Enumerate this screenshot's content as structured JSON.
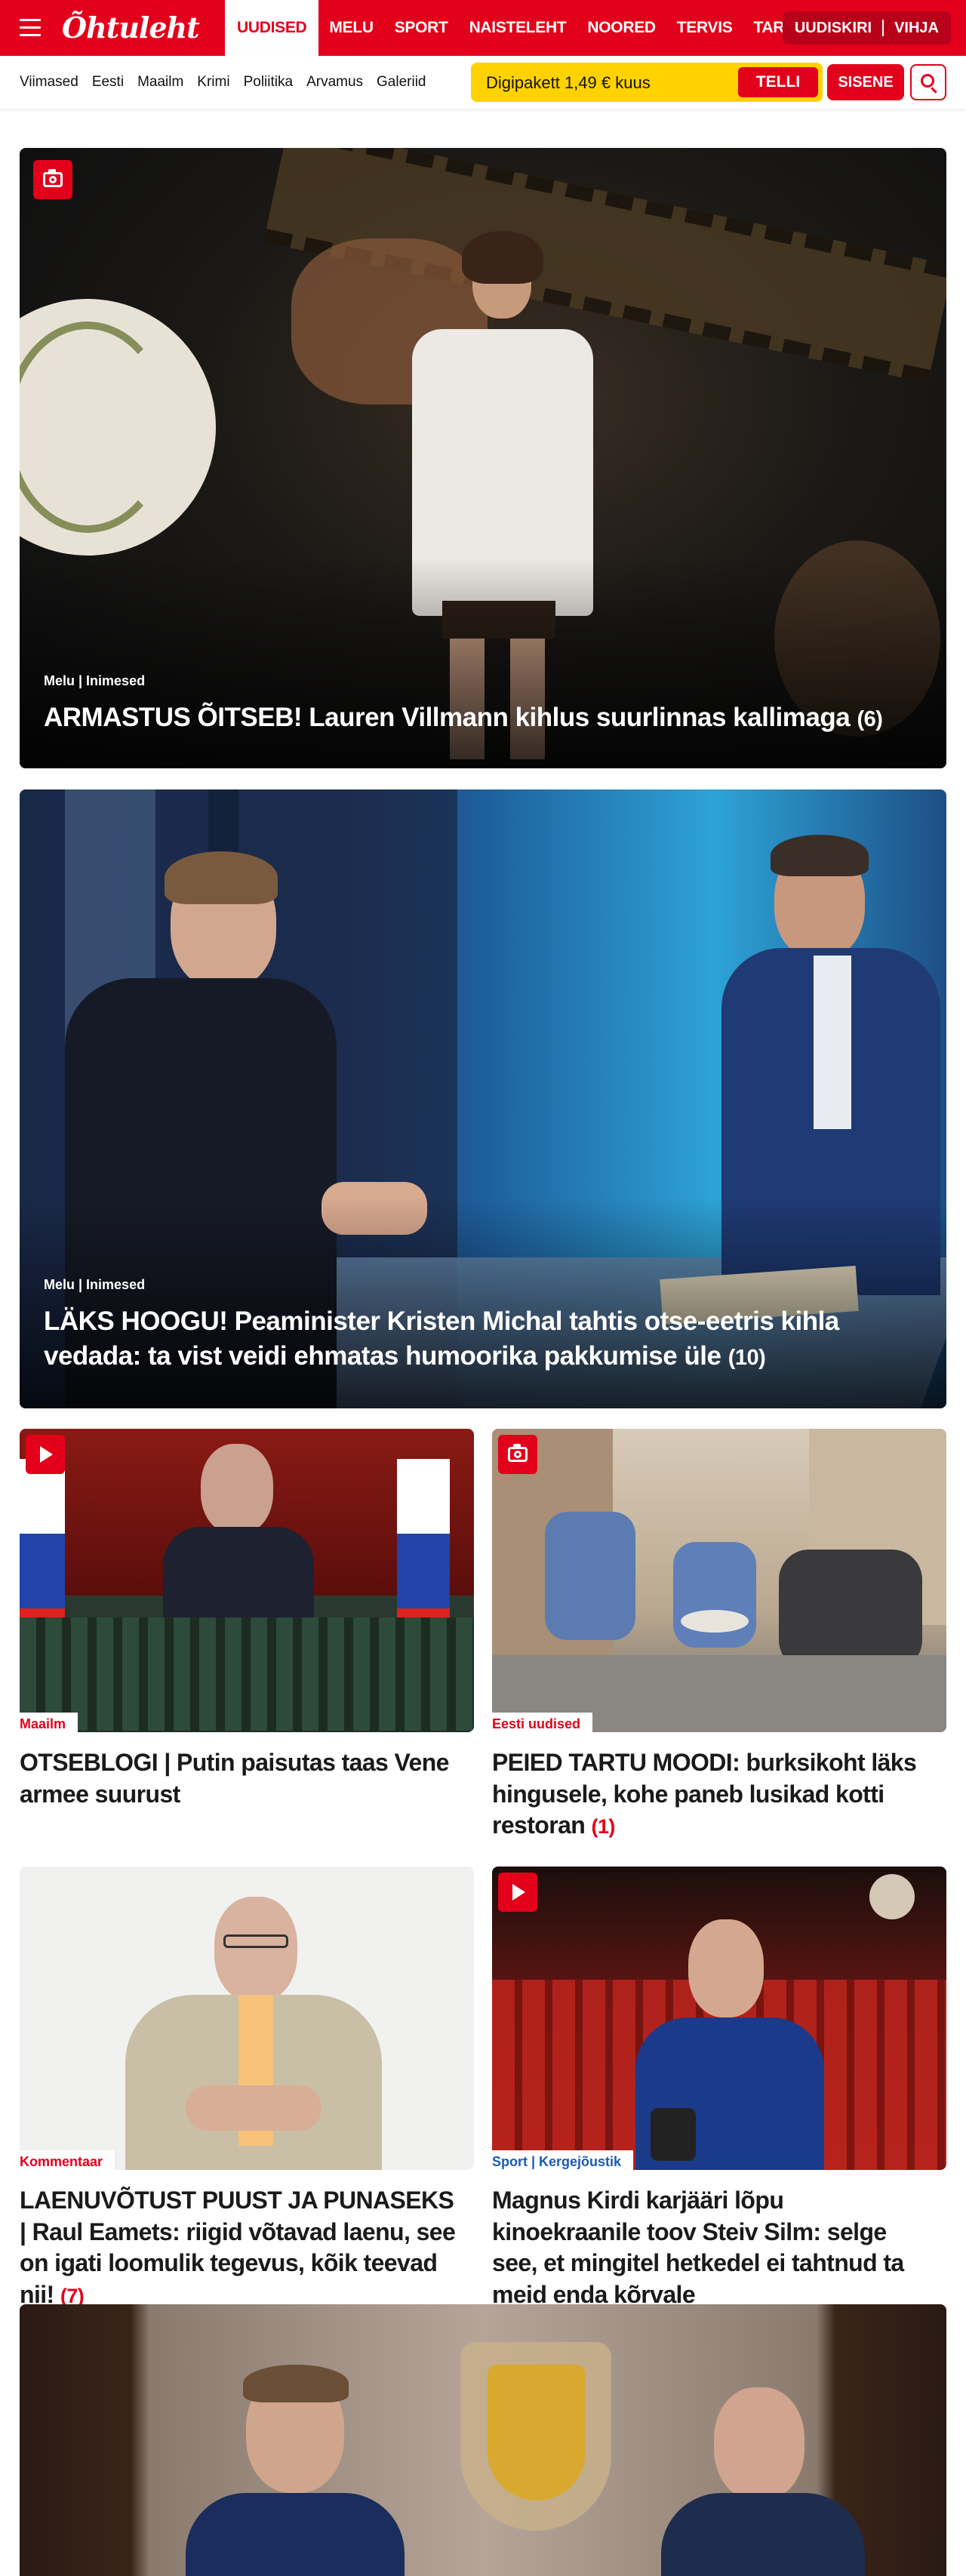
{
  "header": {
    "logo": "Õhtuleht",
    "sections": [
      "UUDISED",
      "MELU",
      "SPORT",
      "NAISTELEHT",
      "NOORED",
      "TERVIS",
      "TARBIJA"
    ],
    "right_links": [
      "UUDISKIRI",
      "VIHJA"
    ]
  },
  "subnav": {
    "links": [
      "Viimased",
      "Eesti",
      "Maailm",
      "Krimi",
      "Poliitika",
      "Arvamus",
      "Galeriid"
    ],
    "promo_text": "Digipakett 1,49 € kuus",
    "promo_button": "TELLI",
    "signin": "SISENE"
  },
  "hero": [
    {
      "category": "Melu | Inimesed",
      "title": "ARMASTUS ÕITSEB! Lauren Villmann kihlus suurlinnas kallimaga",
      "count": "(6)"
    },
    {
      "category": "Melu | Inimesed",
      "title": "LÄKS HOOGU! Peaminister Kristen Michal tahtis otse-eetris kihla vedada: ta vist veidi ehmatas humoorika pakkumise üle",
      "count": "(10)"
    }
  ],
  "cards": [
    {
      "category": "Maailm",
      "title": "OTSEBLOGI | Putin paisutas taas Vene armee suurust",
      "count": ""
    },
    {
      "category": "Eesti uudised",
      "title": "PEIED TARTU MOODI: burksikoht läks hingusele, kohe paneb lusikad kotti restoran",
      "count": "(1)"
    },
    {
      "category": "Kommentaar",
      "title": "LAENUVÕTUST PUUST JA PUNASEKS | Raul Eamets: riigid võtavad laenu, see on igati loomulik tegevus, kõik teevad nii!",
      "count": "(7)"
    },
    {
      "category": "Sport | Kergejõustik",
      "title": "Magnus Kirdi karjääri lõpu kinoekraanile toov Steiv Silm: selge see, et mingitel hetkedel ei tahtnud ta meid enda kõrvale",
      "count": ""
    }
  ]
}
